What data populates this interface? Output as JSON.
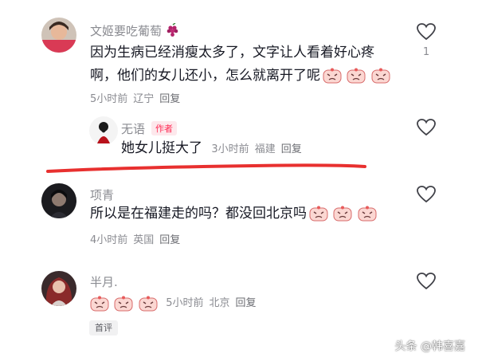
{
  "comments": [
    {
      "username": "文姬要吃葡萄",
      "username_emoji": "grape-icon",
      "text_line1": "因为生病已经消瘦太多了，文字让人看着好心疼",
      "text_line2": "啊，他们的女儿还小，怎么就离开了呢",
      "emojis": [
        "crying-face-icon",
        "crying-face-icon",
        "crying-face-icon"
      ],
      "time": "5小时前",
      "location": "辽宁",
      "reply_label": "回复",
      "like_count": "1"
    },
    {
      "username": "无语",
      "author_tag": "作者",
      "text": "她女儿挺大了",
      "time": "3小时前",
      "location": "福建",
      "reply_label": "回复"
    },
    {
      "username": "项青",
      "text": "所以是在福建走的吗？都没回北京吗",
      "emojis": [
        "crying-face-icon",
        "crying-face-icon",
        "crying-face-icon"
      ],
      "time": "4小时前",
      "location": "英国",
      "reply_label": "回复"
    },
    {
      "username": "半月.",
      "emojis": [
        "crying-face-icon",
        "crying-face-icon",
        "crying-face-icon"
      ],
      "time": "5小时前",
      "location": "北京",
      "reply_label": "回复",
      "first_comment_tag": "首评"
    }
  ],
  "watermark": "头条 @韩喜嘉",
  "colors": {
    "underline": "#e8302f",
    "author_tag": "#fe2c55",
    "meta_text": "#8a8b91"
  }
}
